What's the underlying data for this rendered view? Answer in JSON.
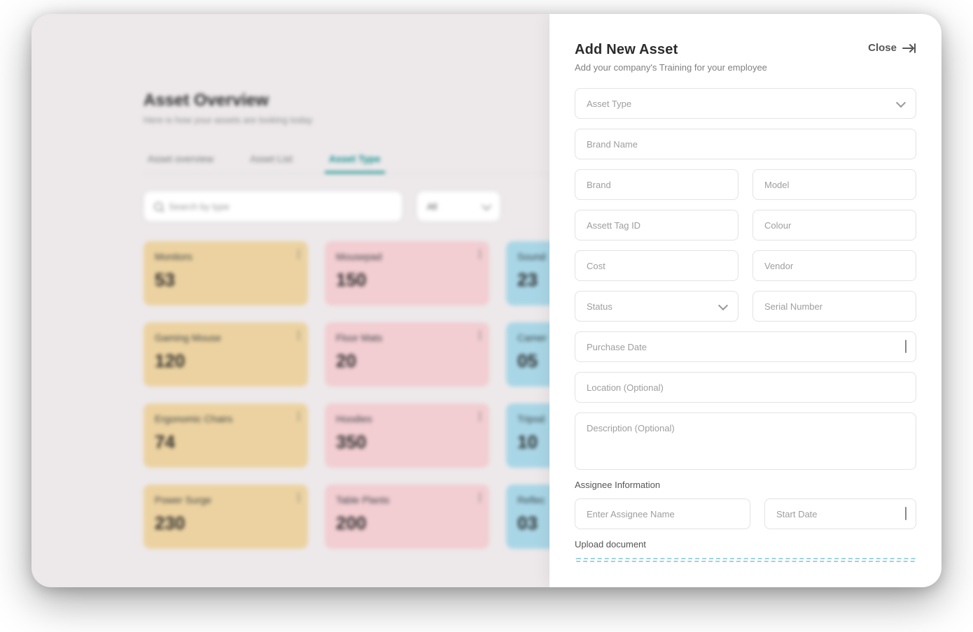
{
  "overview": {
    "title": "Asset Overview",
    "subtitle": "Here is how your assets are looking today",
    "tabs": [
      {
        "label": "Asset overview"
      },
      {
        "label": "Asset List"
      },
      {
        "label": "Asset Type"
      }
    ],
    "search_placeholder": "Search by type",
    "filter_label": "All",
    "cards": [
      {
        "label": "Monitors",
        "value": "53",
        "tone": "yellow"
      },
      {
        "label": "Mousepad",
        "value": "150",
        "tone": "pink"
      },
      {
        "label": "Sound",
        "value": "23",
        "tone": "blue"
      },
      {
        "label": "Gaming Mouse",
        "value": "120",
        "tone": "yellow"
      },
      {
        "label": "Floor Mats",
        "value": "20",
        "tone": "pink"
      },
      {
        "label": "Camer",
        "value": "05",
        "tone": "blue"
      },
      {
        "label": "Ergonomic Chairs",
        "value": "74",
        "tone": "yellow"
      },
      {
        "label": "Hoodies",
        "value": "350",
        "tone": "pink"
      },
      {
        "label": "Tripod",
        "value": "10",
        "tone": "blue"
      },
      {
        "label": "Power Surge",
        "value": "230",
        "tone": "yellow"
      },
      {
        "label": "Table Plants",
        "value": "200",
        "tone": "pink"
      },
      {
        "label": "Reflec",
        "value": "03",
        "tone": "blue"
      }
    ]
  },
  "drawer": {
    "title": "Add New Asset",
    "close_label": "Close",
    "subtitle": "Add your company's Training for your employee",
    "asset_type_placeholder": "Asset Type",
    "brand_name_placeholder": "Brand Name",
    "brand_placeholder": "Brand",
    "model_placeholder": "Model",
    "asset_tag_placeholder": "Assett Tag ID",
    "colour_placeholder": "Colour",
    "cost_placeholder": "Cost",
    "vendor_placeholder": "Vendor",
    "status_placeholder": "Status",
    "serial_placeholder": "Serial Number",
    "purchase_date_placeholder": "Purchase Date",
    "location_placeholder": "Location (Optional)",
    "description_placeholder": "Description (Optional)",
    "assignee_section": "Assignee Information",
    "assignee_name_placeholder": "Enter Assignee Name",
    "start_date_placeholder": "Start Date",
    "upload_section": "Upload document"
  }
}
